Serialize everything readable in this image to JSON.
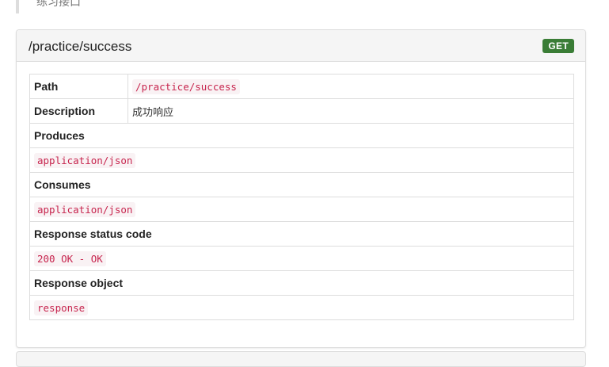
{
  "previous_section": {
    "text": "练习接口"
  },
  "endpoint": {
    "title": "/practice/success",
    "method": "GET",
    "rows": {
      "path_label": "Path",
      "path_value": "/practice/success",
      "description_label": "Description",
      "description_value": "成功响应",
      "produces_label": "Produces",
      "produces_value": "application/json",
      "consumes_label": "Consumes",
      "consumes_value": "application/json",
      "status_label": "Response status code",
      "status_value": "200 OK - OK",
      "object_label": "Response object",
      "object_value": "response"
    }
  },
  "colors": {
    "badge_get": "#3a7d36",
    "code_text": "#c7254e",
    "code_bg": "#f9f2f4",
    "border": "#dddddd",
    "heading_bg": "#f5f5f5"
  }
}
